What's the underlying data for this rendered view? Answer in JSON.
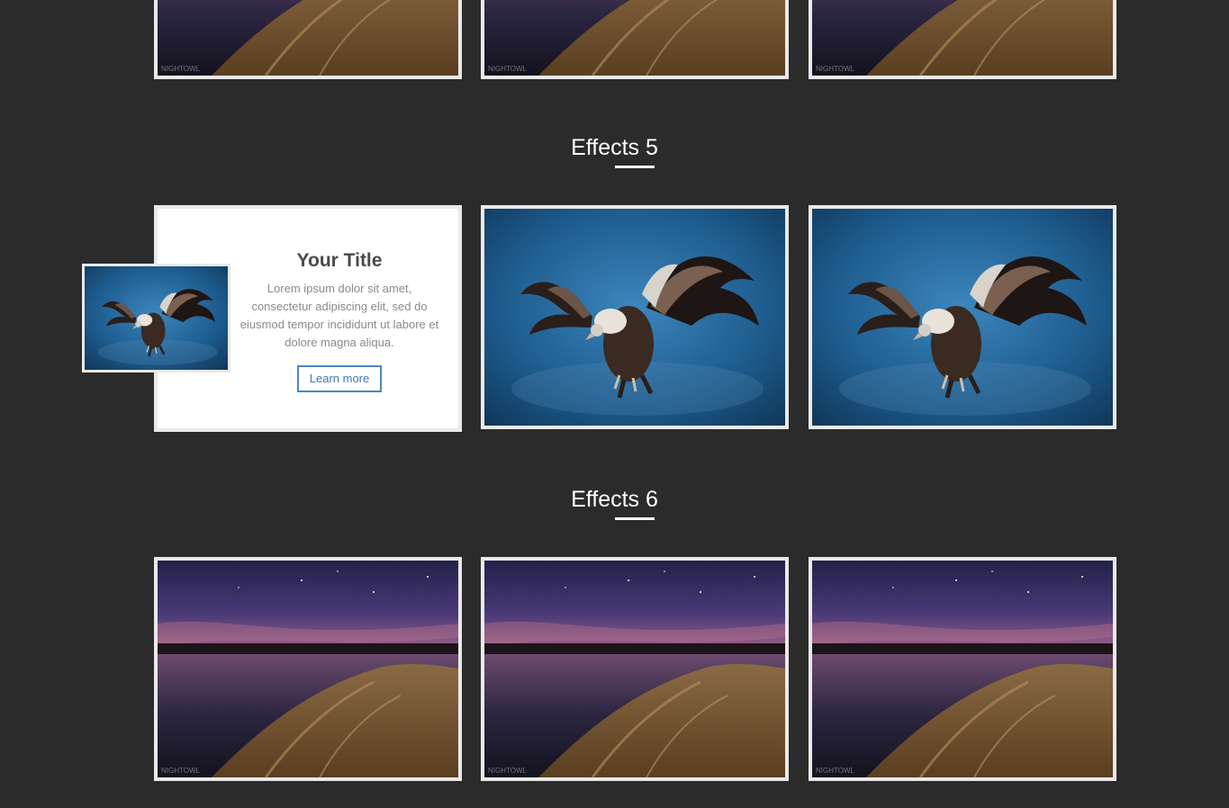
{
  "sections": [
    {
      "heading": "Effects 5"
    },
    {
      "heading": "Effects 6"
    }
  ],
  "card": {
    "title": "Your Title",
    "text": "Lorem ipsum dolor sit amet, consectetur adipiscing elit, sed do eiusmod tempor incididunt ut labore et dolore magna aliqua.",
    "button_label": "Learn more"
  },
  "watermark": "NIGHTOWL",
  "colors": {
    "page_background": "#2b2b2b",
    "frame_border": "#e9e9e9",
    "accent_button": "#4c87c5"
  }
}
